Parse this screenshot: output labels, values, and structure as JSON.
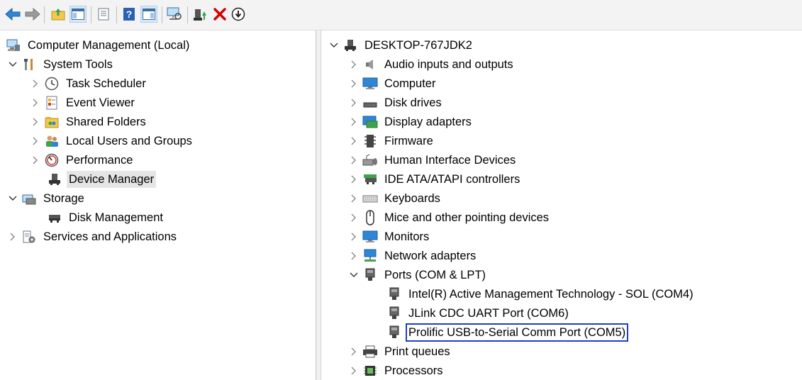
{
  "toolbar": {
    "buttons": [
      {
        "name": "back-icon"
      },
      {
        "name": "forward-icon"
      },
      {
        "name": "up-folder-icon"
      },
      {
        "name": "show-hide-tree-icon"
      },
      {
        "name": "properties-icon"
      },
      {
        "name": "help-icon"
      },
      {
        "name": "show-hide-action-pane-icon"
      },
      {
        "name": "scan-hardware-icon"
      },
      {
        "name": "update-driver-icon"
      },
      {
        "name": "uninstall-device-icon"
      },
      {
        "name": "disable-device-icon"
      }
    ]
  },
  "left_tree": {
    "root": "Computer Management (Local)",
    "system_tools": "System Tools",
    "task_scheduler": "Task Scheduler",
    "event_viewer": "Event Viewer",
    "shared_folders": "Shared Folders",
    "local_users": "Local Users and Groups",
    "performance": "Performance",
    "device_manager": "Device Manager",
    "storage": "Storage",
    "disk_management": "Disk Management",
    "services": "Services and Applications"
  },
  "right_tree": {
    "computer_name": "DESKTOP-767JDK2",
    "categories": {
      "audio": "Audio inputs and outputs",
      "computer": "Computer",
      "disk_drives": "Disk drives",
      "display": "Display adapters",
      "firmware": "Firmware",
      "hid": "Human Interface Devices",
      "ide": "IDE ATA/ATAPI controllers",
      "keyboards": "Keyboards",
      "mice": "Mice and other pointing devices",
      "monitors": "Monitors",
      "network": "Network adapters",
      "ports": "Ports (COM & LPT)",
      "print_queues": "Print queues",
      "processors": "Processors"
    },
    "ports_children": {
      "intel_sol": "Intel(R) Active Management Technology - SOL (COM4)",
      "jlink": "JLink CDC UART Port (COM6)",
      "prolific": "Prolific USB-to-Serial Comm Port (COM5)"
    }
  },
  "colors": {
    "focus_outline": "#1f3fc8",
    "selection_bg": "#e5e5e5",
    "delete_red": "#d40000"
  }
}
